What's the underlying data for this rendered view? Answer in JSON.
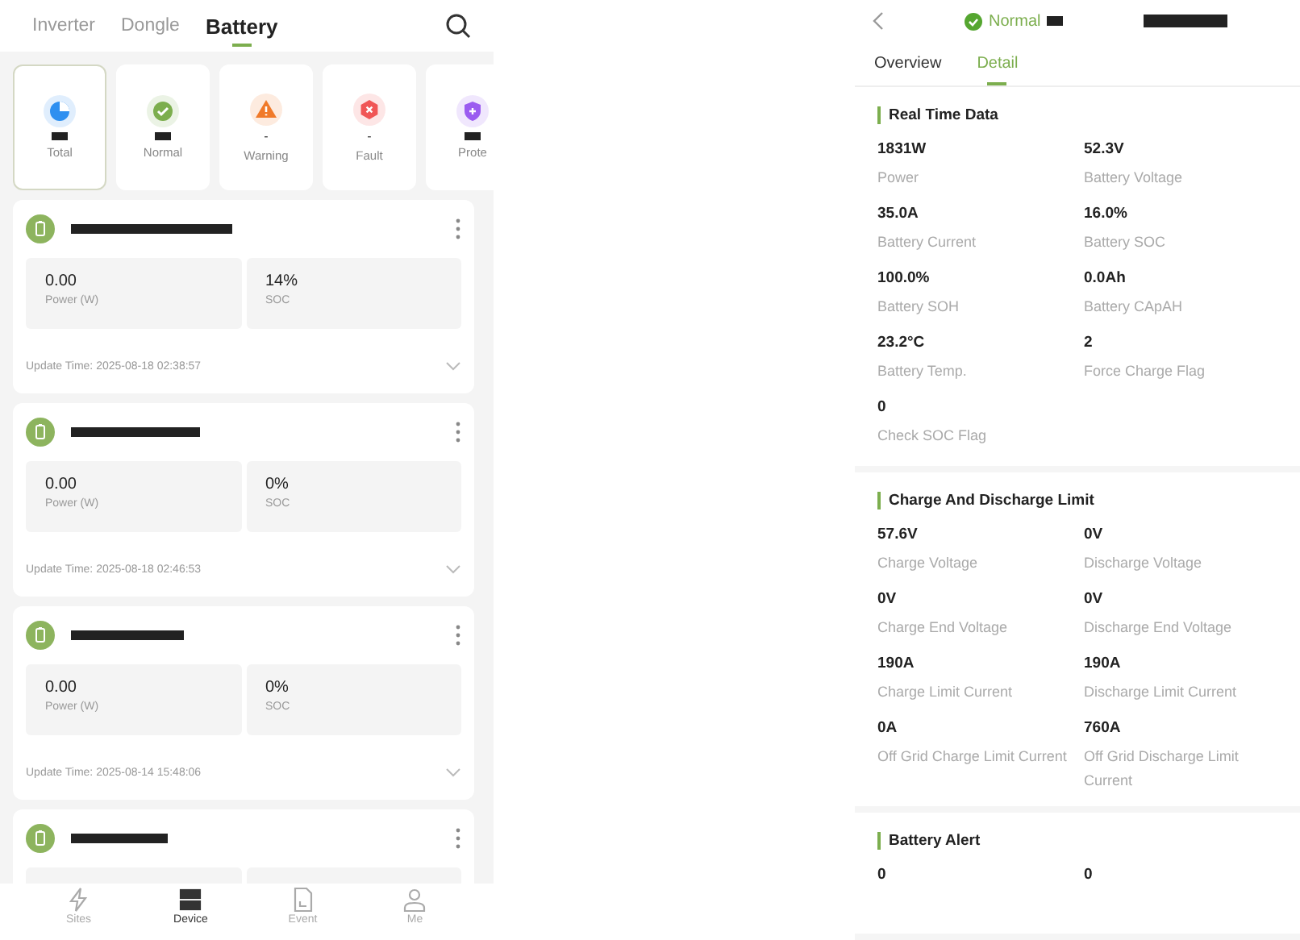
{
  "device_list": {
    "tabs": [
      {
        "label": "Inverter",
        "selected": false
      },
      {
        "label": "Dongle",
        "selected": false
      },
      {
        "label": "Battery",
        "selected": true
      }
    ],
    "status_cards": [
      {
        "kind": "total",
        "label": "Total",
        "selected": true
      },
      {
        "kind": "normal",
        "label": "Normal",
        "selected": false
      },
      {
        "kind": "warning",
        "label": "Warning",
        "count": "-",
        "selected": false
      },
      {
        "kind": "fault",
        "label": "Fault",
        "count": "-",
        "selected": false
      },
      {
        "kind": "protect",
        "label": "Prote",
        "selected": false
      }
    ],
    "devices": [
      {
        "metrics": [
          {
            "value": "0.00",
            "label": "Power (W)"
          },
          {
            "value": "14%",
            "label": "SOC"
          }
        ],
        "update_time": "Update Time: 2025-08-18 02:38:57"
      },
      {
        "metrics": [
          {
            "value": "0.00",
            "label": "Power (W)"
          },
          {
            "value": "0%",
            "label": "SOC"
          }
        ],
        "update_time": "Update Time: 2025-08-18 02:46:53"
      },
      {
        "metrics": [
          {
            "value": "0.00",
            "label": "Power (W)"
          },
          {
            "value": "0%",
            "label": "SOC"
          }
        ],
        "update_time": "Update Time: 2025-08-14 15:48:06"
      },
      {
        "kind": "cut_off"
      }
    ],
    "nav": [
      {
        "kind": "sites",
        "label": "Sites",
        "selected": false
      },
      {
        "kind": "device",
        "label": "Device",
        "selected": true
      },
      {
        "kind": "event",
        "label": "Event",
        "selected": false
      },
      {
        "kind": "me",
        "label": "Me",
        "selected": false
      }
    ]
  },
  "device_detail": {
    "status": "Normal",
    "tabs": [
      {
        "label": "Overview",
        "selected": false
      },
      {
        "label": "Detail",
        "selected": true
      }
    ],
    "sections": [
      {
        "title": "Real Time Data",
        "items": [
          {
            "value": "1831W",
            "label": "Power"
          },
          {
            "value": "52.3V",
            "label": "Battery Voltage"
          },
          {
            "value": "35.0A",
            "label": "Battery Current"
          },
          {
            "value": "16.0%",
            "label": "Battery SOC"
          },
          {
            "value": "100.0%",
            "label": "Battery SOH"
          },
          {
            "value": "0.0Ah",
            "label": "Battery CApAH"
          },
          {
            "value": "23.2°C",
            "label": "Battery Temp."
          },
          {
            "value": "2",
            "label": "Force Charge Flag"
          },
          {
            "value": "0",
            "label": "Check SOC Flag"
          }
        ]
      },
      {
        "title": "Charge And Discharge Limit",
        "items": [
          {
            "value": "57.6V",
            "label": "Charge Voltage"
          },
          {
            "value": "0V",
            "label": "Discharge Voltage"
          },
          {
            "value": "0V",
            "label": "Charge End Voltage"
          },
          {
            "value": "0V",
            "label": "Discharge End Voltage"
          },
          {
            "value": "190A",
            "label": "Charge Limit Current"
          },
          {
            "value": "190A",
            "label": "Discharge Limit Current"
          },
          {
            "value": "0A",
            "label": "Off Grid Charge Limit Current"
          },
          {
            "value": "760A",
            "label": "Off Grid Discharge Limit Current"
          }
        ]
      },
      {
        "title": "Battery Alert",
        "items": [
          {
            "value": "0"
          },
          {
            "value": "0"
          }
        ]
      }
    ]
  }
}
